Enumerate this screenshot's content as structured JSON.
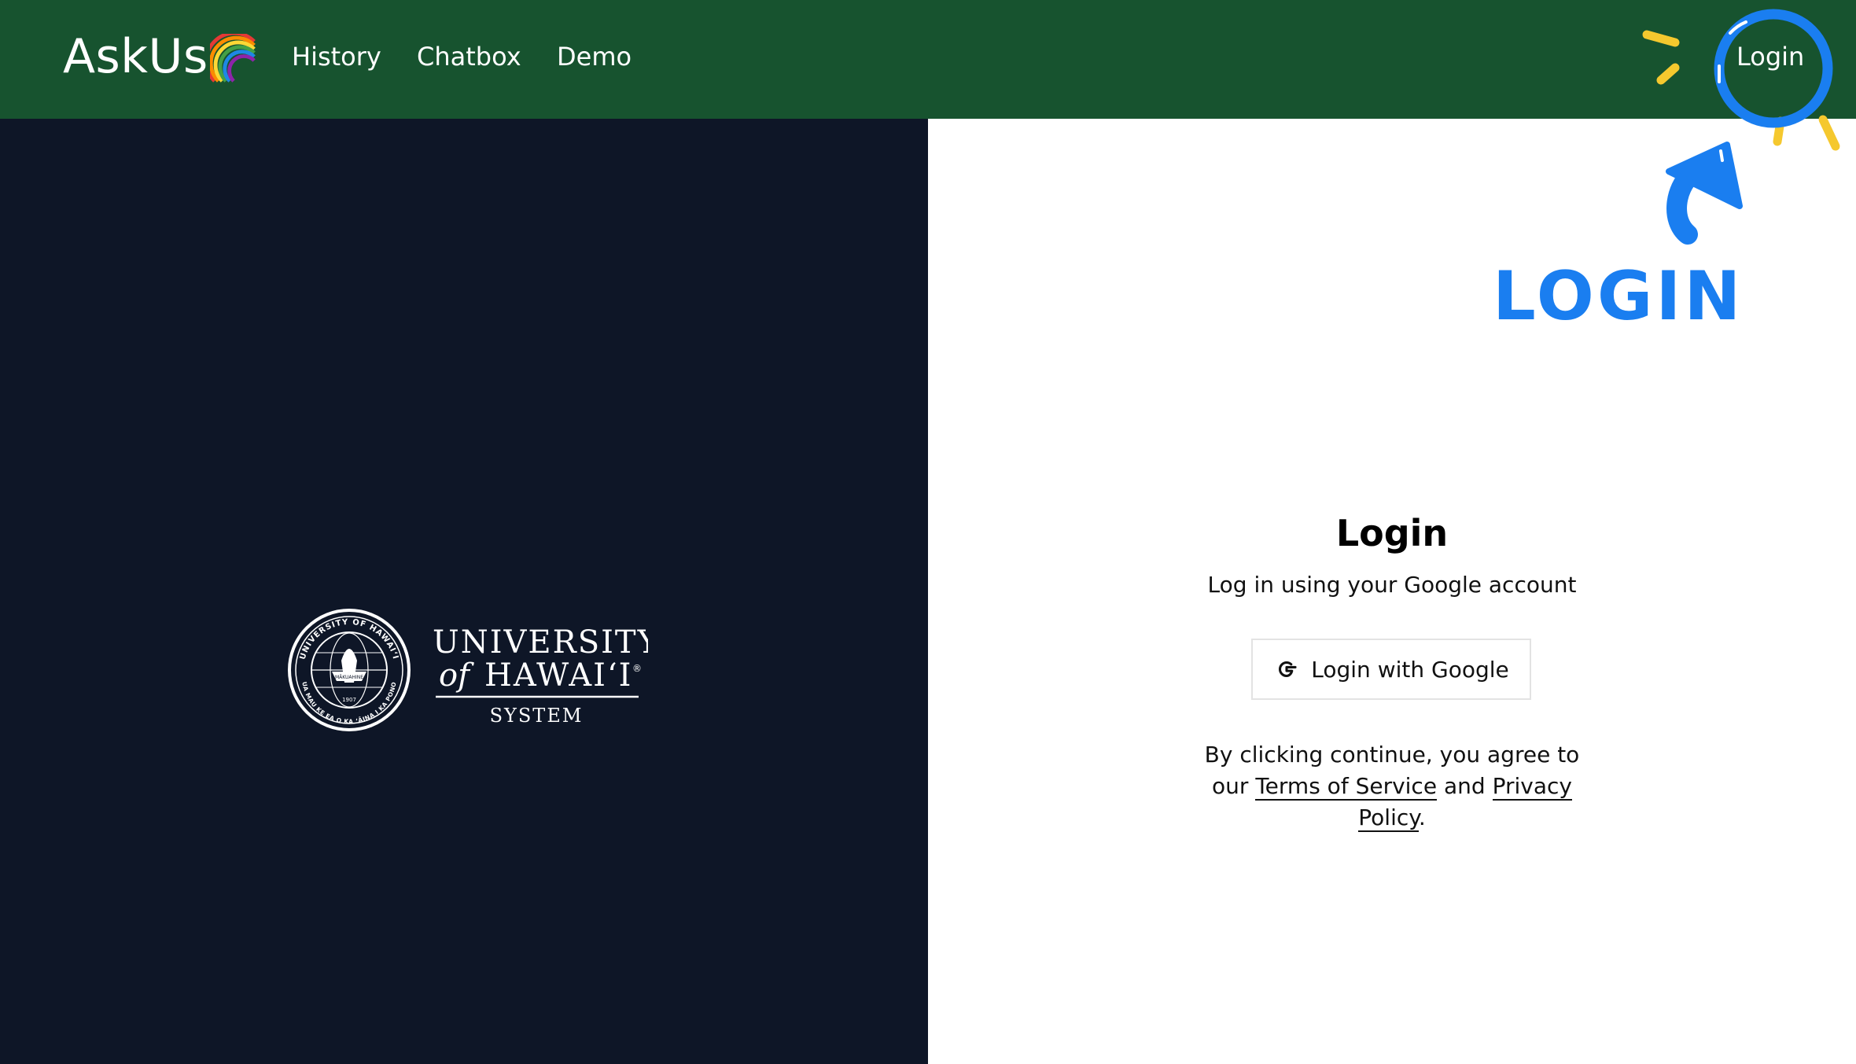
{
  "header": {
    "brand": "AskUs",
    "brand_icon": "rainbow-icon",
    "nav": [
      "History",
      "Chatbox",
      "Demo"
    ],
    "login": "Login",
    "background": "#17532f"
  },
  "annotation": {
    "text": "LOGIN",
    "color": "#1a7ef0",
    "accent": "#f5c82e"
  },
  "left_panel": {
    "background": "#0e1627",
    "logo": {
      "line1": "UNIVERSITY",
      "line2_prefix": "of",
      "line2": "HAWAI‘I",
      "mark": "®",
      "line3": "SYSTEM",
      "seal_top": "UNIVERSITY OF HAWAI‘I",
      "seal_bottom": "UA MAU KE EA O KA ‘ĀINA I KA PONO",
      "seal_banner": "MĀKUAHINE",
      "seal_year": "1907"
    }
  },
  "login_panel": {
    "title": "Login",
    "subtitle": "Log in using your Google account",
    "google_button": "Login with Google",
    "terms": {
      "prefix": "By clicking continue, you agree to our",
      "terms_link": "Terms of Service",
      "and": "and",
      "privacy_link": "Privacy Policy",
      "suffix": "."
    }
  }
}
